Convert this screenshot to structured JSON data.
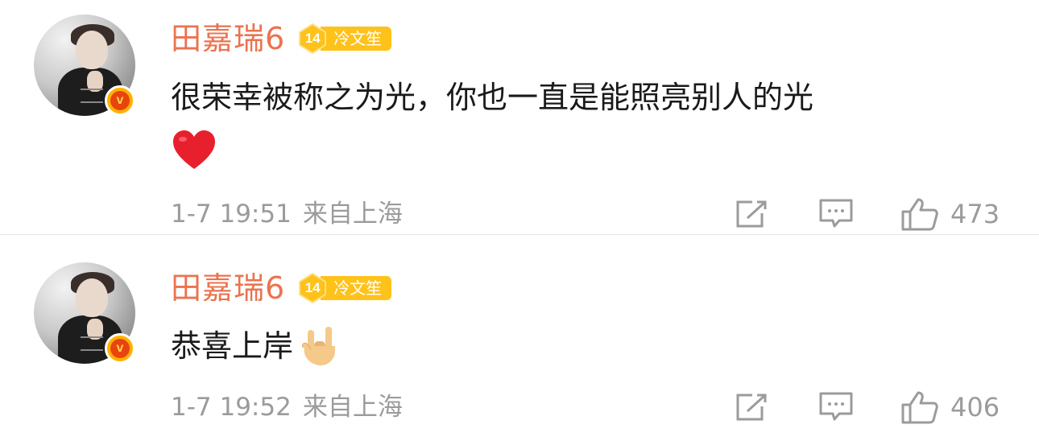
{
  "comments": [
    {
      "user": {
        "name": "田嘉瑞6",
        "verified_label": "v"
      },
      "fan_badge": {
        "level": "14",
        "name": "冷文笙"
      },
      "text": "很荣幸被称之为光，你也一直是能照亮别人的光",
      "emoji": "heart",
      "time": "1-7 19:51",
      "location": "来自上海",
      "likes": "473"
    },
    {
      "user": {
        "name": "田嘉瑞6",
        "verified_label": "v"
      },
      "fan_badge": {
        "level": "14",
        "name": "冷文笙"
      },
      "text": "恭喜上岸",
      "emoji": "rock-on-hand",
      "time": "1-7 19:52",
      "location": "来自上海",
      "likes": "406"
    }
  ],
  "icons": {
    "share": "share-icon",
    "comment": "comment-icon",
    "like": "thumbs-up-icon"
  },
  "colors": {
    "username": "#eb7350",
    "badge_bg": "#ffc21a",
    "meta_gray": "#9b9b9b",
    "verified_badge": "#ffb100"
  }
}
